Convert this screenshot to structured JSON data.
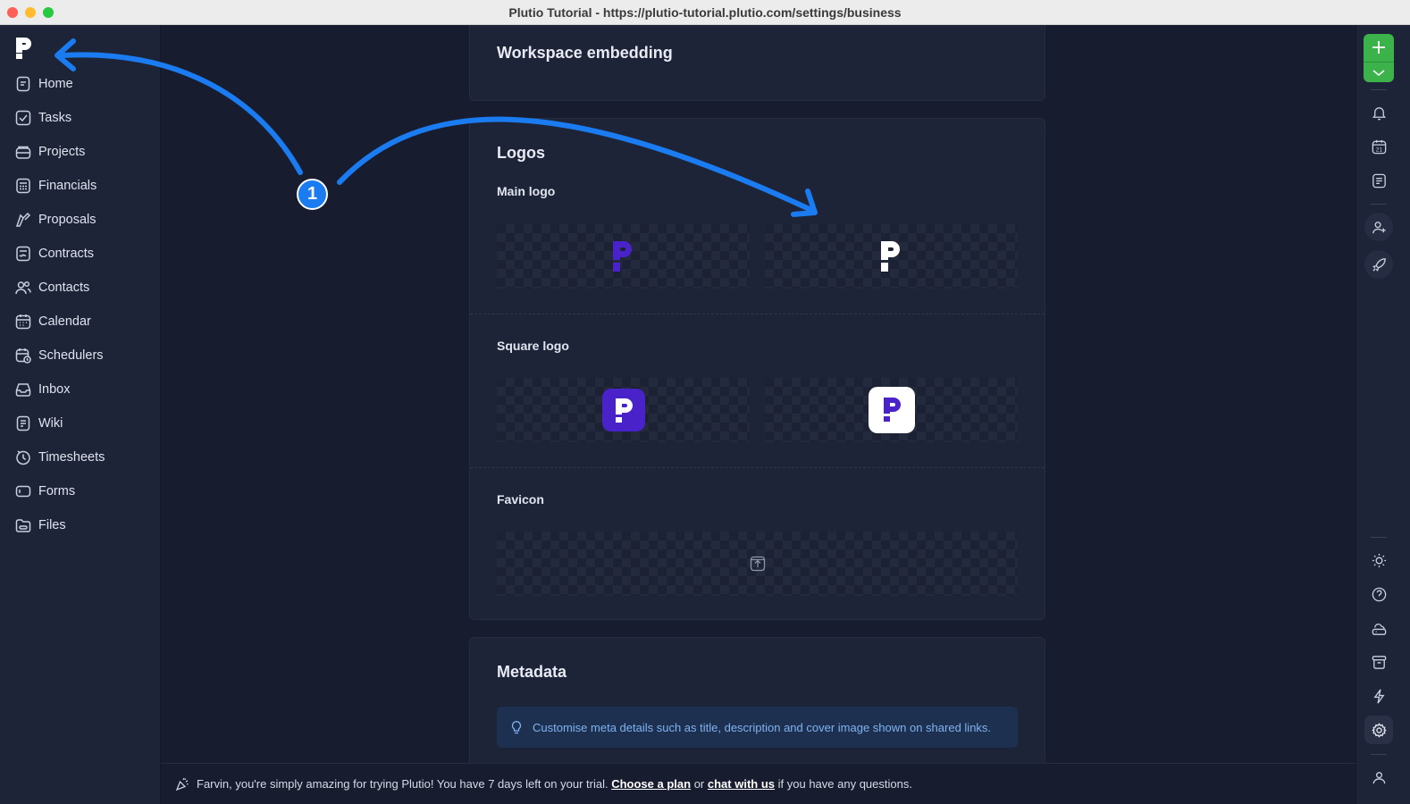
{
  "window": {
    "title": "Plutio Tutorial - https://plutio-tutorial.plutio.com/settings/business"
  },
  "sidebar": {
    "brand_icon": "plutio-logo-icon",
    "items": [
      {
        "label": "Home",
        "icon": "home-icon"
      },
      {
        "label": "Tasks",
        "icon": "tasks-icon"
      },
      {
        "label": "Projects",
        "icon": "projects-icon"
      },
      {
        "label": "Financials",
        "icon": "financials-icon"
      },
      {
        "label": "Proposals",
        "icon": "proposals-icon"
      },
      {
        "label": "Contracts",
        "icon": "contracts-icon"
      },
      {
        "label": "Contacts",
        "icon": "contacts-icon"
      },
      {
        "label": "Calendar",
        "icon": "calendar-icon"
      },
      {
        "label": "Schedulers",
        "icon": "schedulers-icon"
      },
      {
        "label": "Inbox",
        "icon": "inbox-icon"
      },
      {
        "label": "Wiki",
        "icon": "wiki-icon"
      },
      {
        "label": "Timesheets",
        "icon": "timesheets-icon"
      },
      {
        "label": "Forms",
        "icon": "forms-icon"
      },
      {
        "label": "Files",
        "icon": "files-icon"
      }
    ]
  },
  "main": {
    "embedding_title": "Workspace embedding",
    "logos": {
      "title": "Logos",
      "main_logo_label": "Main logo",
      "square_logo_label": "Square logo",
      "favicon_label": "Favicon"
    },
    "metadata": {
      "title": "Metadata",
      "info": "Customise meta details such as title, description and cover image shown on shared links."
    }
  },
  "trial_bar": {
    "text_before": "Farvin, you're simply amazing for trying Plutio! You have 7 days left on your trial.",
    "choose_plan": "Choose a plan",
    "or": "or",
    "chat": "chat with us",
    "text_after": "if you have any questions."
  },
  "annotation": {
    "badge": "1"
  },
  "colors": {
    "accent_purple": "#4a22c9",
    "add_green": "#3bb24a",
    "annotation_blue": "#1a7cf0",
    "info_text": "#7fb2f0"
  }
}
